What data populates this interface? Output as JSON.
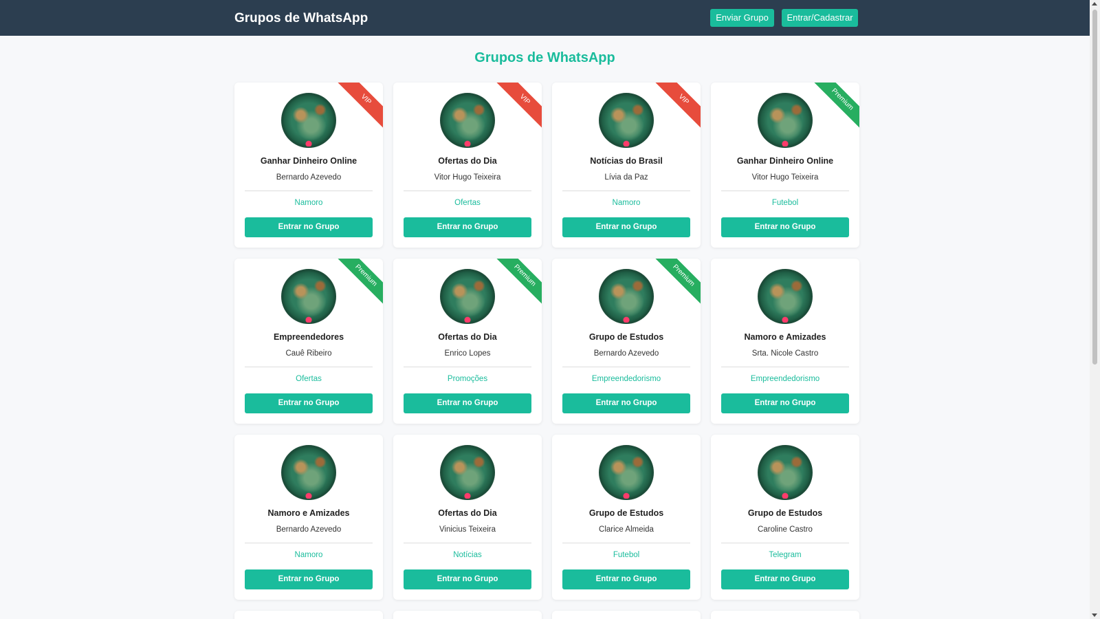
{
  "header": {
    "brand": "Grupos de WhatsApp",
    "send_button": "Enviar Grupo",
    "login_button": "Entrar/Cadastrar"
  },
  "main": {
    "title": "Grupos de WhatsApp",
    "enter_label": "Entrar no Grupo",
    "cards": [
      {
        "name": "Ganhar Dinheiro Online",
        "owner": "Bernardo Azevedo",
        "category": "Namoro",
        "badge": "VIP"
      },
      {
        "name": "Ofertas do Dia",
        "owner": "Vitor Hugo Teixeira",
        "category": "Ofertas",
        "badge": "VIP"
      },
      {
        "name": "Notícias do Brasil",
        "owner": "Lívia da Paz",
        "category": "Namoro",
        "badge": "VIP"
      },
      {
        "name": "Ganhar Dinheiro Online",
        "owner": "Vitor Hugo Teixeira",
        "category": "Futebol",
        "badge": "Premium"
      },
      {
        "name": "Empreendedores",
        "owner": "Cauê Ribeiro",
        "category": "Ofertas",
        "badge": "Premium"
      },
      {
        "name": "Ofertas do Dia",
        "owner": "Enrico Lopes",
        "category": "Promoções",
        "badge": "Premium"
      },
      {
        "name": "Grupo de Estudos",
        "owner": "Bernardo Azevedo",
        "category": "Empreendedorismo",
        "badge": "Premium"
      },
      {
        "name": "Namoro e Amizades",
        "owner": "Srta. Nicole Castro",
        "category": "Empreendedorismo",
        "badge": ""
      },
      {
        "name": "Namoro e Amizades",
        "owner": "Bernardo Azevedo",
        "category": "Namoro",
        "badge": ""
      },
      {
        "name": "Ofertas do Dia",
        "owner": "Vinicius Teixeira",
        "category": "Notícias",
        "badge": ""
      },
      {
        "name": "Grupo de Estudos",
        "owner": "Clarice Almeida",
        "category": "Futebol",
        "badge": ""
      },
      {
        "name": "Grupo de Estudos",
        "owner": "Caroline Castro",
        "category": "Telegram",
        "badge": ""
      }
    ]
  },
  "colors": {
    "header_bg": "#2c3e50",
    "accent": "#1abc9c",
    "vip": "#e74c3c",
    "premium": "#27ae60"
  }
}
